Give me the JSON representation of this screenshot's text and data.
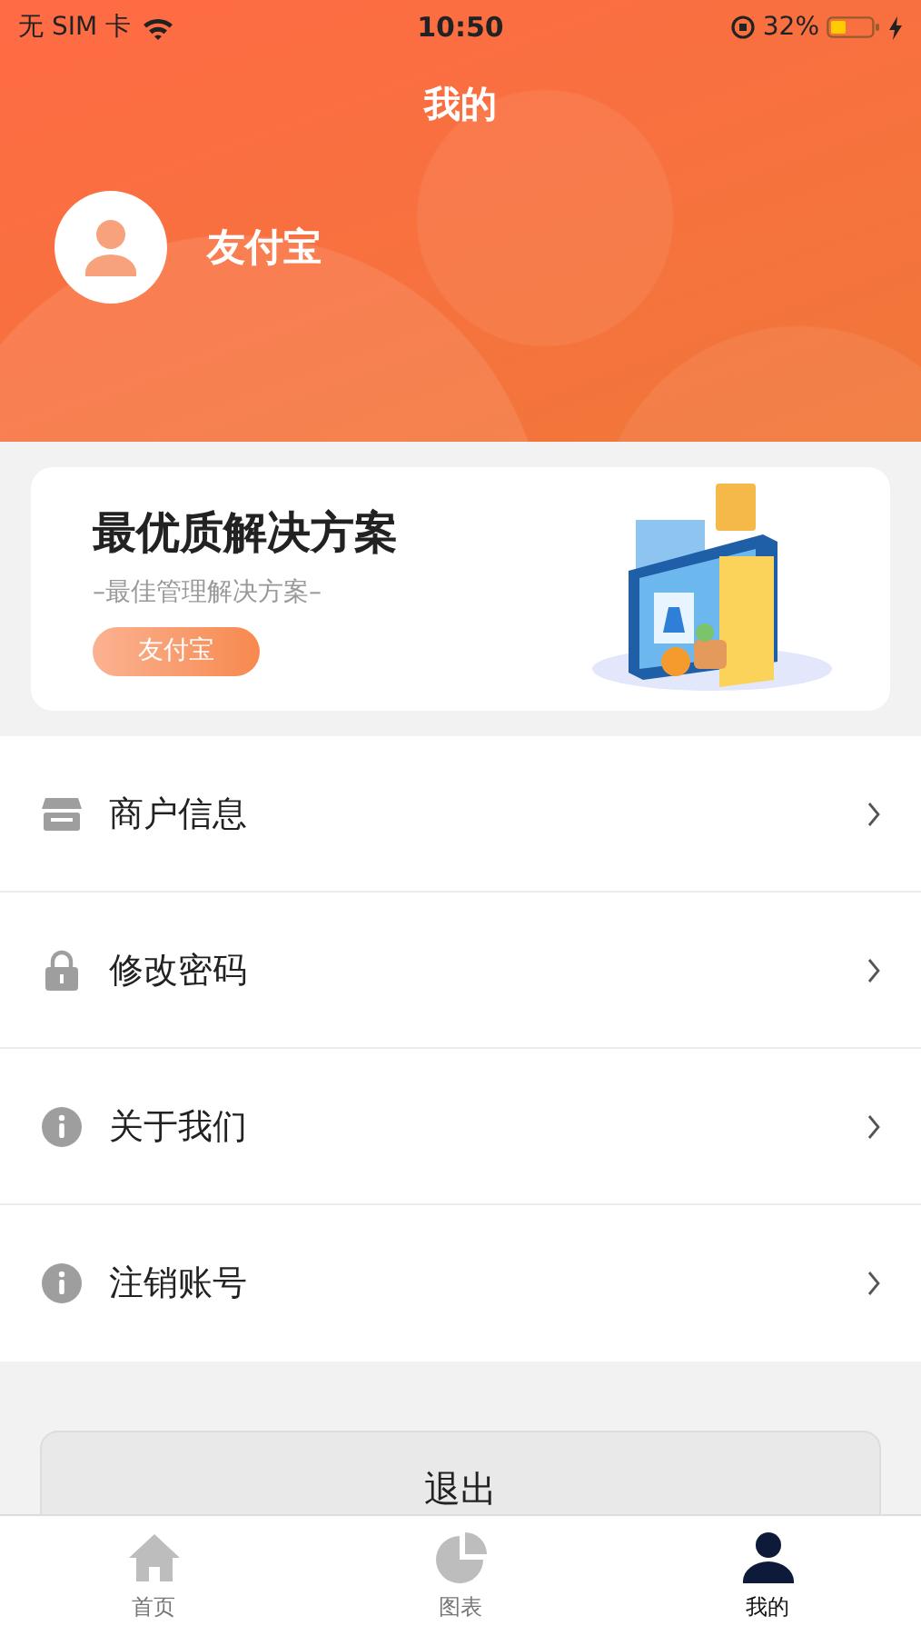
{
  "status_bar": {
    "carrier": "无 SIM 卡",
    "time": "10:50",
    "battery": "32%"
  },
  "header": {
    "title": "我的",
    "user_name": "友付宝"
  },
  "banner": {
    "title": "最优质解决方案",
    "subtitle": "–最佳管理解决方案–",
    "button": "友付宝"
  },
  "menu": [
    {
      "label": "商户信息",
      "kind": "store"
    },
    {
      "label": "修改密码",
      "kind": "lock"
    },
    {
      "label": "关于我们",
      "kind": "info"
    },
    {
      "label": "注销账号",
      "kind": "info"
    }
  ],
  "logout_button": "退出",
  "tabs": [
    {
      "label": "首页",
      "kind": "home",
      "selected": false
    },
    {
      "label": "图表",
      "kind": "chart",
      "selected": false
    },
    {
      "label": "我的",
      "kind": "user",
      "selected": true
    }
  ]
}
